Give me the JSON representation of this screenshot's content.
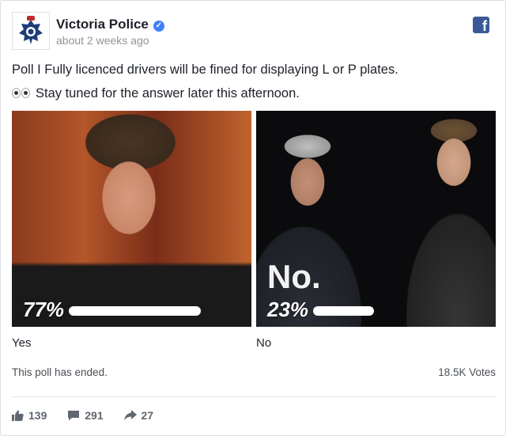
{
  "post": {
    "page_name": "Victoria Police",
    "timestamp": "about 2 weeks ago",
    "line1": "Poll I Fully licenced drivers will be fined for displaying L or P plates.",
    "line2": "Stay tuned for the answer later this afternoon.",
    "eyes_emoji": "eyes-emoji",
    "brand_color": "#3b5998"
  },
  "poll": {
    "options": [
      {
        "label": "Yes",
        "percent_text": "77%",
        "percent": 77,
        "image_caption": ""
      },
      {
        "label": "No",
        "percent_text": "23%",
        "percent": 23,
        "image_caption": "No."
      }
    ],
    "status": "This poll has ended.",
    "votes": "18.5K Votes"
  },
  "actions": {
    "likes": "139",
    "comments": "291",
    "shares": "27"
  },
  "icons": [
    "police-badge-icon",
    "verified-icon",
    "facebook-icon",
    "like-icon",
    "comment-icon",
    "share-icon"
  ]
}
